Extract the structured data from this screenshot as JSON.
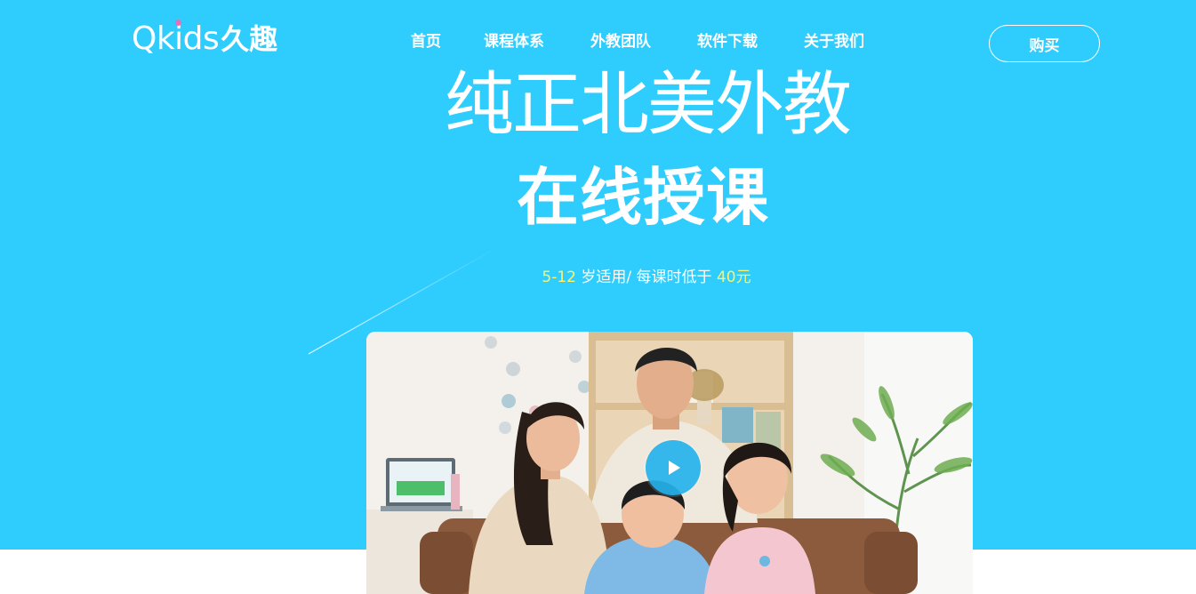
{
  "brand": {
    "logo_latin": "Qkids",
    "logo_cn": "久趣",
    "logo_dot_color": "#e76fb6"
  },
  "nav": {
    "items": [
      {
        "label": "首页"
      },
      {
        "label": "课程体系"
      },
      {
        "label": "外教团队"
      },
      {
        "label": "软件下载"
      },
      {
        "label": "关于我们"
      }
    ],
    "buy_label": "购买"
  },
  "hero": {
    "background_color": "#2ecdfd",
    "headline_1": "纯正北美外教",
    "headline_2": "在线授课",
    "subline_age": "5-12",
    "subline_mid": " 岁适用/ 每课时低于 ",
    "subline_price": "40元",
    "highlight_color": "#fff26a"
  },
  "video": {
    "play_icon": "play-icon"
  }
}
